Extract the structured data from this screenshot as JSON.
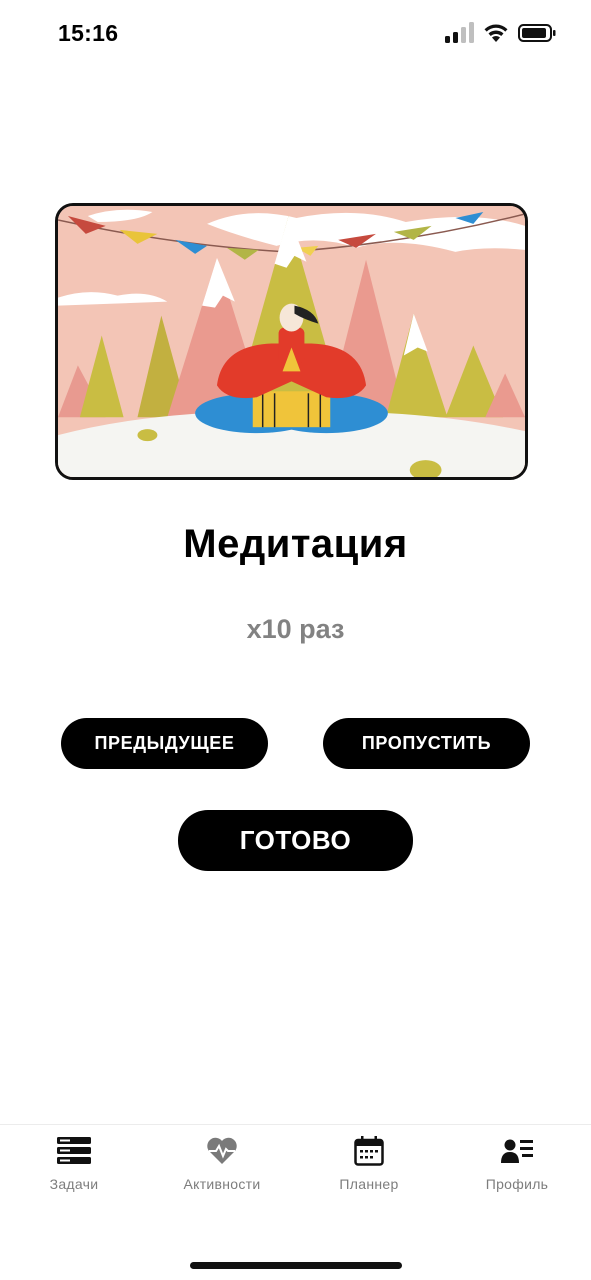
{
  "status_bar": {
    "time": "15:16",
    "icons": [
      "cellular-signal-icon",
      "wifi-icon",
      "battery-icon"
    ]
  },
  "exercise": {
    "illustration": "meditation-illustration",
    "title": "Медитация",
    "repetitions": "x10 раз"
  },
  "controls": {
    "previous_label": "ПРЕДЫДУЩЕЕ",
    "skip_label": "ПРОПУСТИТЬ",
    "done_label": "ГОТОВО"
  },
  "tab_bar": {
    "items": [
      {
        "label": "Задачи",
        "icon": "tasks-icon"
      },
      {
        "label": "Активности",
        "icon": "heart-pulse-icon"
      },
      {
        "label": "Планнер",
        "icon": "calendar-icon"
      },
      {
        "label": "Профиль",
        "icon": "profile-icon"
      }
    ]
  },
  "colors": {
    "background": "#ffffff",
    "button": "#000000",
    "button_text": "#ffffff",
    "secondary_text": "#828282",
    "tab_label": "#7d7d7d"
  }
}
